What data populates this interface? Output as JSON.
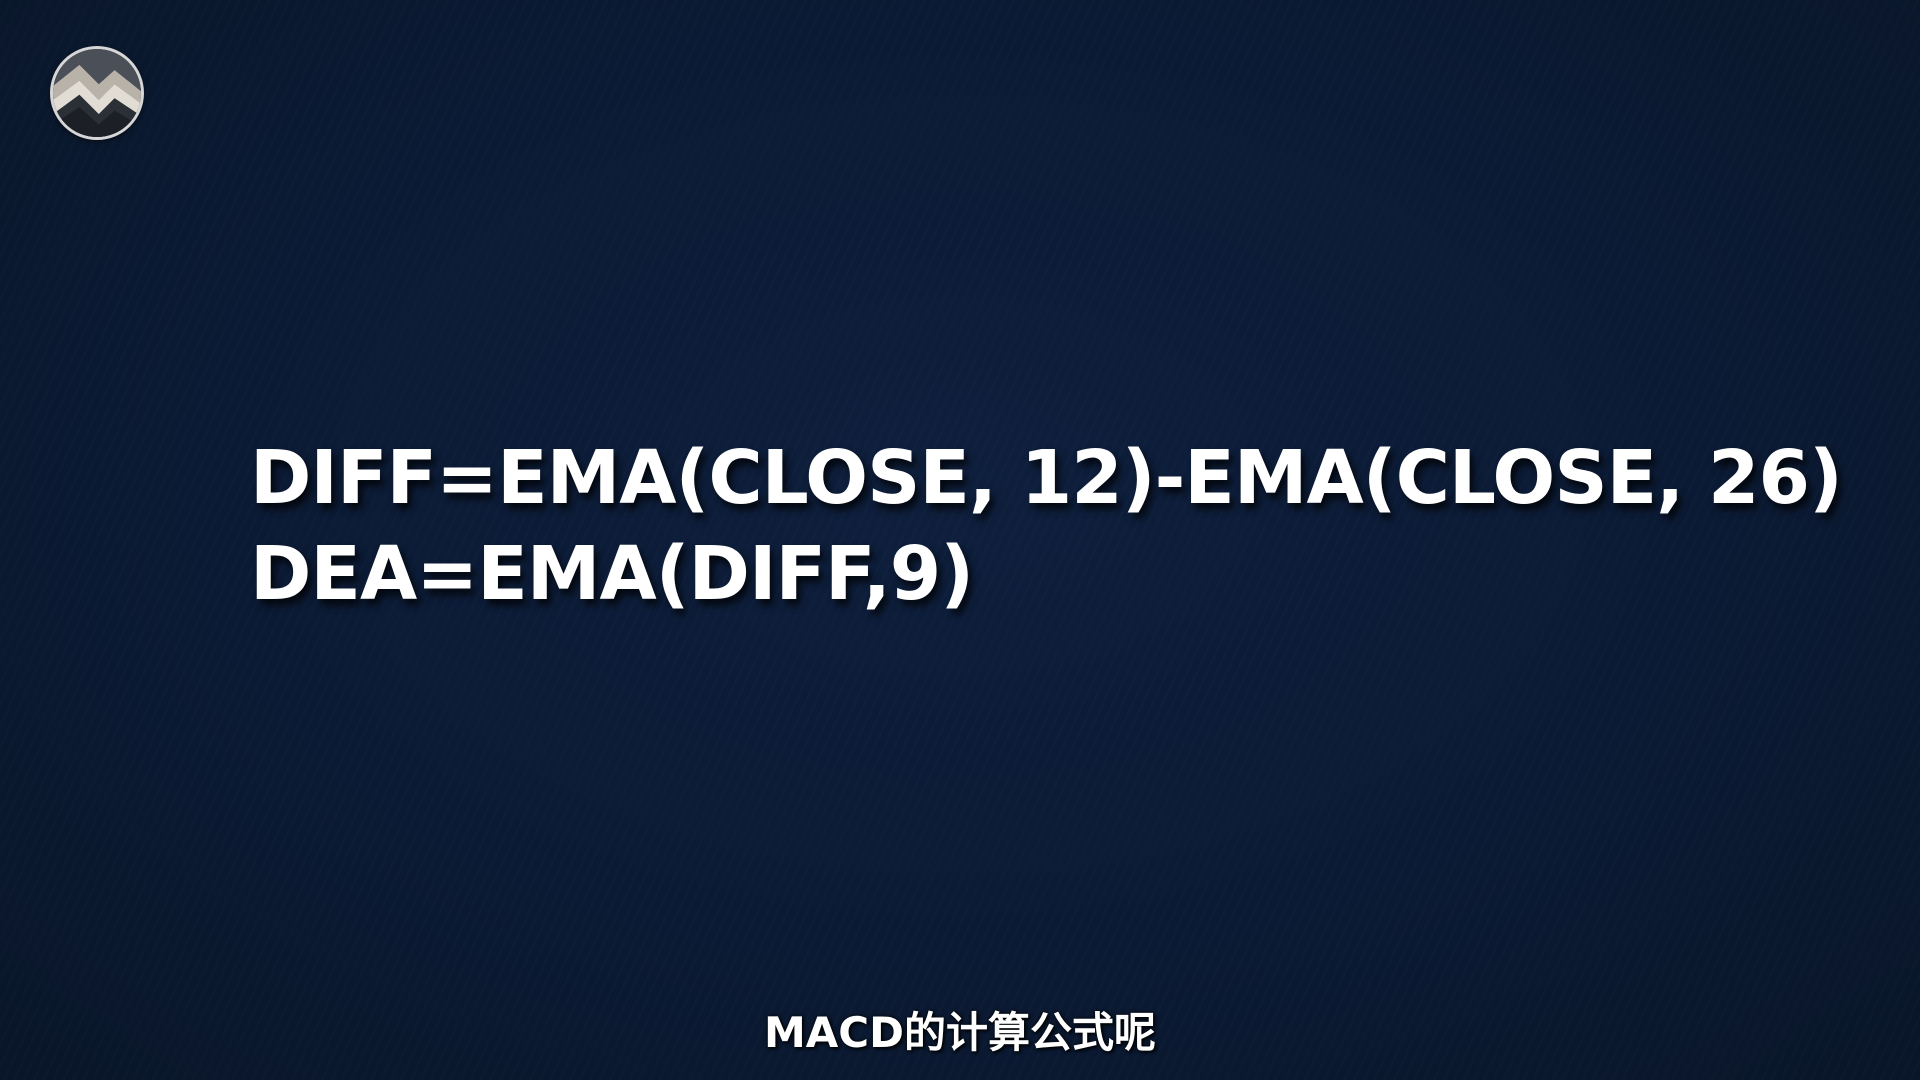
{
  "logo": {
    "icon": "mountain-logo-icon"
  },
  "formula": {
    "lines": [
      "DIFF=EMA(CLOSE, 12)-EMA(CLOSE, 26)",
      "DEA=EMA(DIFF,9)"
    ]
  },
  "subtitle": {
    "text": "MACD的计算公式呢"
  },
  "colors": {
    "background": "#0b1a34",
    "text": "#ffffff",
    "logo_border": "#d6d6d6"
  }
}
